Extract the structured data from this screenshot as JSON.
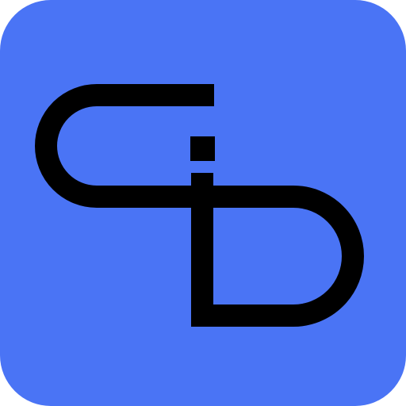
{
  "icon": {
    "name": "app-icon",
    "glyph": "stylized-s-d-monogram-icon",
    "colors": {
      "background": "#4a74f5",
      "stroke": "#000000"
    }
  }
}
